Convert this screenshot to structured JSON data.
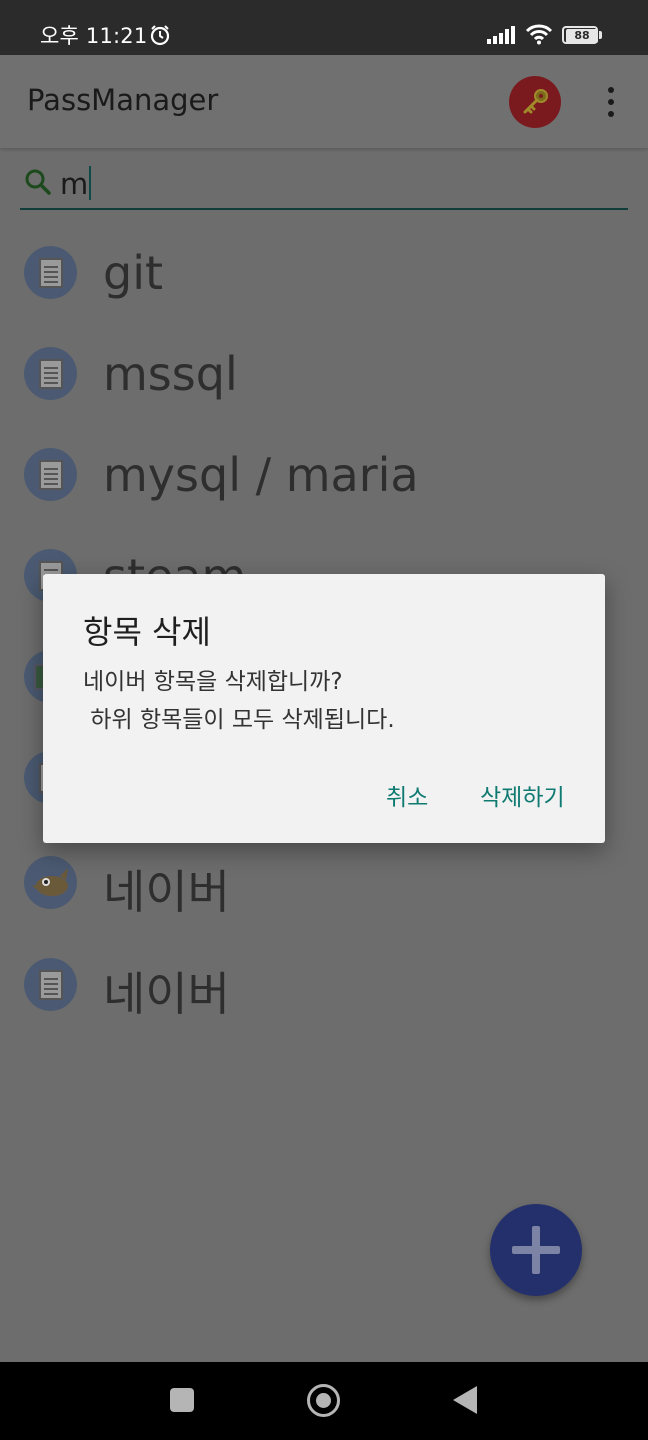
{
  "status_bar": {
    "time": "오후 11:21",
    "battery": "88"
  },
  "app_bar": {
    "title": "PassManager"
  },
  "search": {
    "value": "m"
  },
  "list": {
    "items": [
      {
        "label": "git",
        "icon": "document-icon"
      },
      {
        "label": "mssql",
        "icon": "document-icon"
      },
      {
        "label": "mysql / maria",
        "icon": "document-icon"
      },
      {
        "label": "steam",
        "icon": "document-icon"
      },
      {
        "label": "",
        "icon": "image-icon"
      },
      {
        "label": "",
        "icon": "document-icon"
      },
      {
        "label": "네이버",
        "icon": "gimp-mascot-icon"
      },
      {
        "label": "네이버",
        "icon": "document-icon"
      }
    ]
  },
  "dialog": {
    "title": "항목 삭제",
    "message": "네이버 항목을 삭제합니까?\n 하위 항목들이 모두 삭제됩니다.",
    "cancel_label": "취소",
    "confirm_label": "삭제하기"
  },
  "colors": {
    "accent": "#0f7a72",
    "fab": "#24306b",
    "dialog_bg": "#f2f2f2"
  }
}
